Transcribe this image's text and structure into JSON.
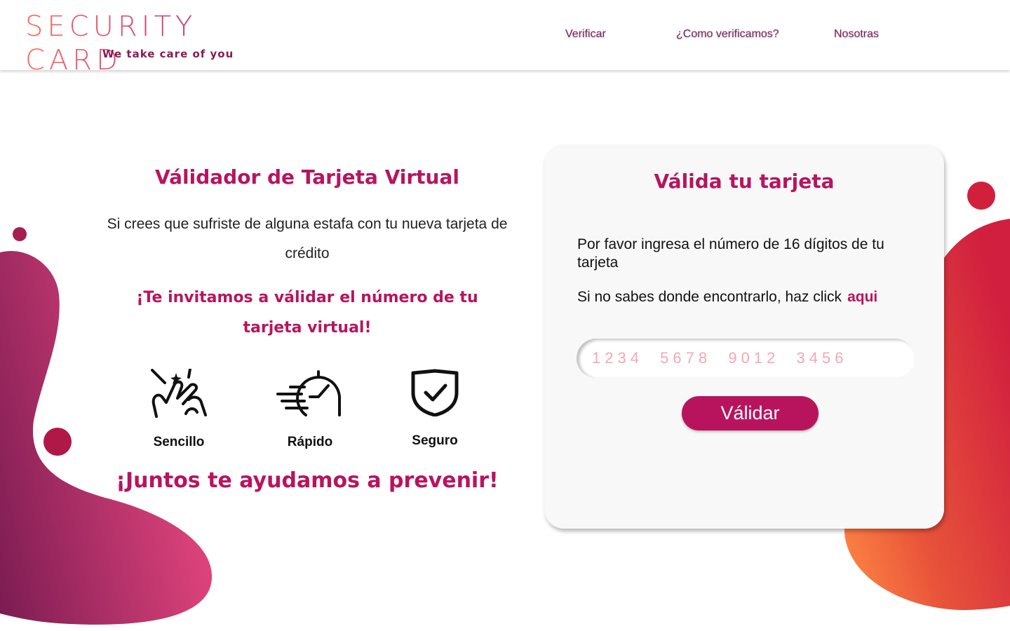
{
  "header": {
    "logo_text": "SECURITY CARD",
    "logo_tagline": "We take care of you",
    "nav": [
      "Verificar",
      "¿Como verificamos?",
      "Nosotras"
    ]
  },
  "left": {
    "title": "Válidador de Tarjeta Virtual",
    "intro": "Si crees que sufriste de alguna estafa con tu nueva tarjeta de crédito",
    "invite": "¡Te invitamos a válidar el número de tu tarjeta virtual!",
    "features": [
      {
        "icon": "magic-hand-icon",
        "label": "Sencillo"
      },
      {
        "icon": "fast-clock-icon",
        "label": "Rápido"
      },
      {
        "icon": "shield-check-icon",
        "label": "Seguro"
      }
    ],
    "closing": "¡Juntos te ayudamos a prevenir!"
  },
  "card": {
    "title": "Válida tu tarjeta",
    "instruction": "Por favor ingresa el número de 16 dígitos de tu tarjeta",
    "help_text": "Si no sabes donde encontrarlo, haz click",
    "help_link": "aqui",
    "input_placeholder": "1234  5678  9012  3456",
    "button_label": "Válidar"
  },
  "colors": {
    "brand": "#b8145e",
    "nav_text": "#7a1f5c",
    "blob_left_start": "#7a1c52",
    "blob_left_end": "#e8477f",
    "blob_right_start": "#d11f3f",
    "blob_right_end": "#ff8a45"
  }
}
